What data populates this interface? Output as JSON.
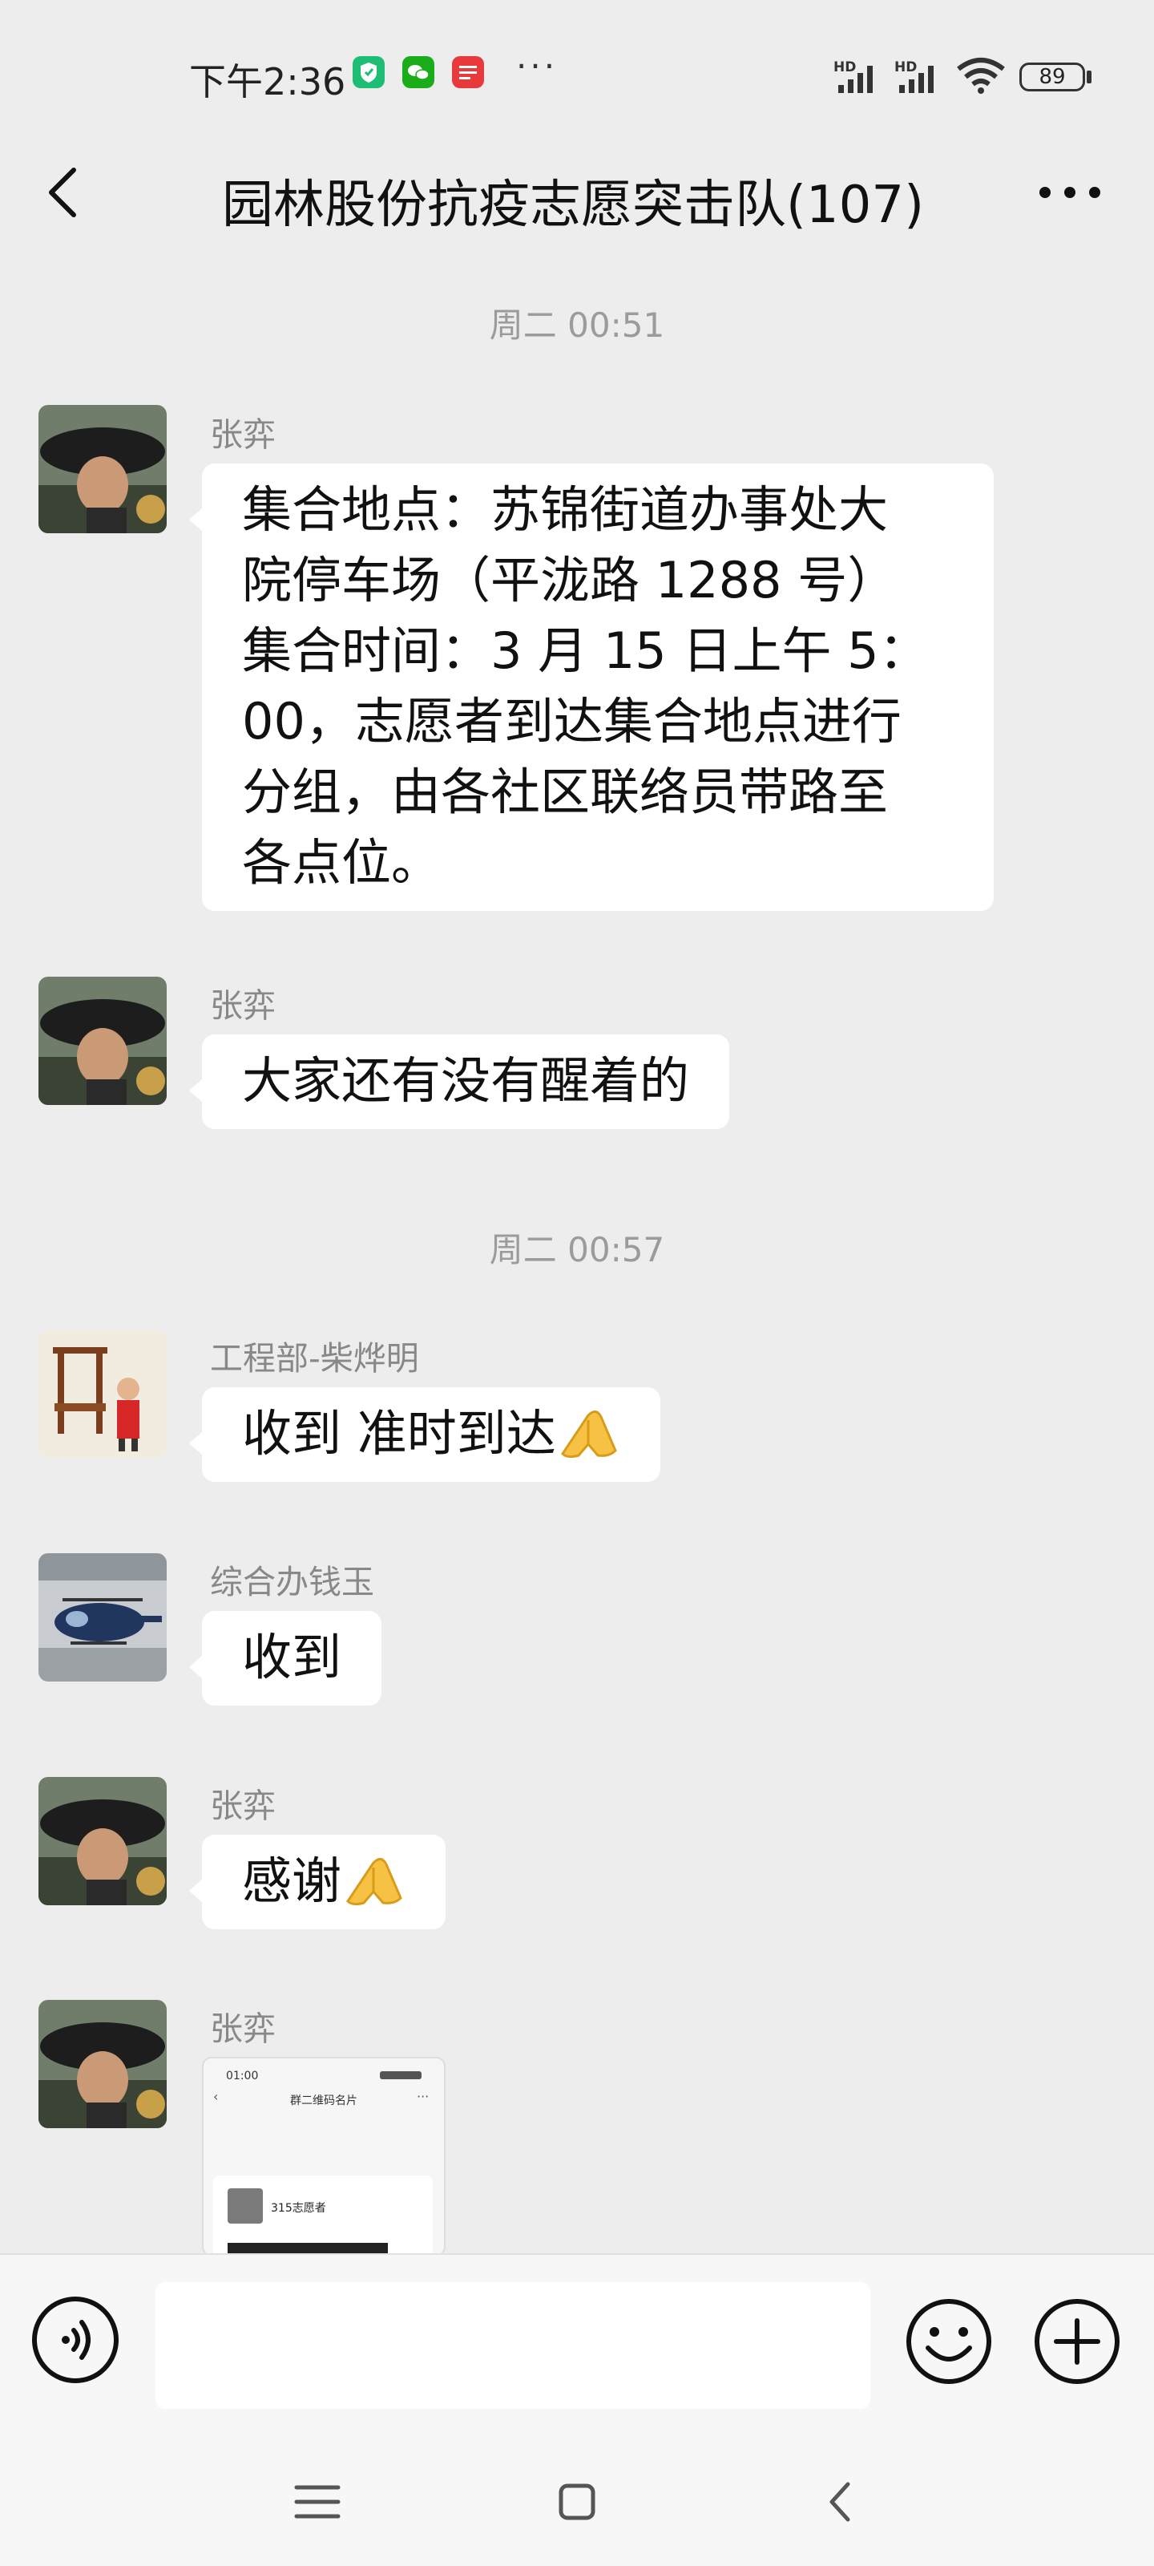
{
  "status_bar": {
    "time": "下午2:36",
    "app_badges": [
      "shield-icon",
      "wechat-icon",
      "sohu-news-icon"
    ],
    "more": "···",
    "network_label_1": "HD",
    "network_label_2": "HD",
    "battery": "89"
  },
  "nav": {
    "title": "园林股份抗疫志愿突击队(107)"
  },
  "messages": [
    {
      "type": "timestamp",
      "text": "周二 00:51"
    },
    {
      "type": "text",
      "sender": "张弈",
      "lines": [
        "集合地点：苏锦街道办事处大",
        "院停车场（平泷路 1288 号）",
        "集合时间：3 月 15 日上午 5：",
        "00，志愿者到达集合地点进行",
        "分组，由各社区联络员带路至",
        "各点位。"
      ]
    },
    {
      "type": "text",
      "sender": "张弈",
      "text": "大家还有没有醒着的"
    },
    {
      "type": "timestamp",
      "text": "周二 00:57"
    },
    {
      "type": "text",
      "sender": "工程部-柴烨明",
      "text": "收到 准时到达"
    },
    {
      "type": "text",
      "sender": "综合办钱玉",
      "text": "收到"
    },
    {
      "type": "text",
      "sender": "张弈",
      "text": "感谢"
    },
    {
      "type": "image",
      "sender": "张弈",
      "preview": {
        "time": "01:00",
        "title": "群二维码名片",
        "card_name": "315志愿者"
      }
    }
  ],
  "input": {
    "value": "",
    "placeholder": ""
  },
  "colors": {
    "background": "#ededed",
    "bubble": "#ffffff",
    "input_bar": "#f7f7f7"
  }
}
